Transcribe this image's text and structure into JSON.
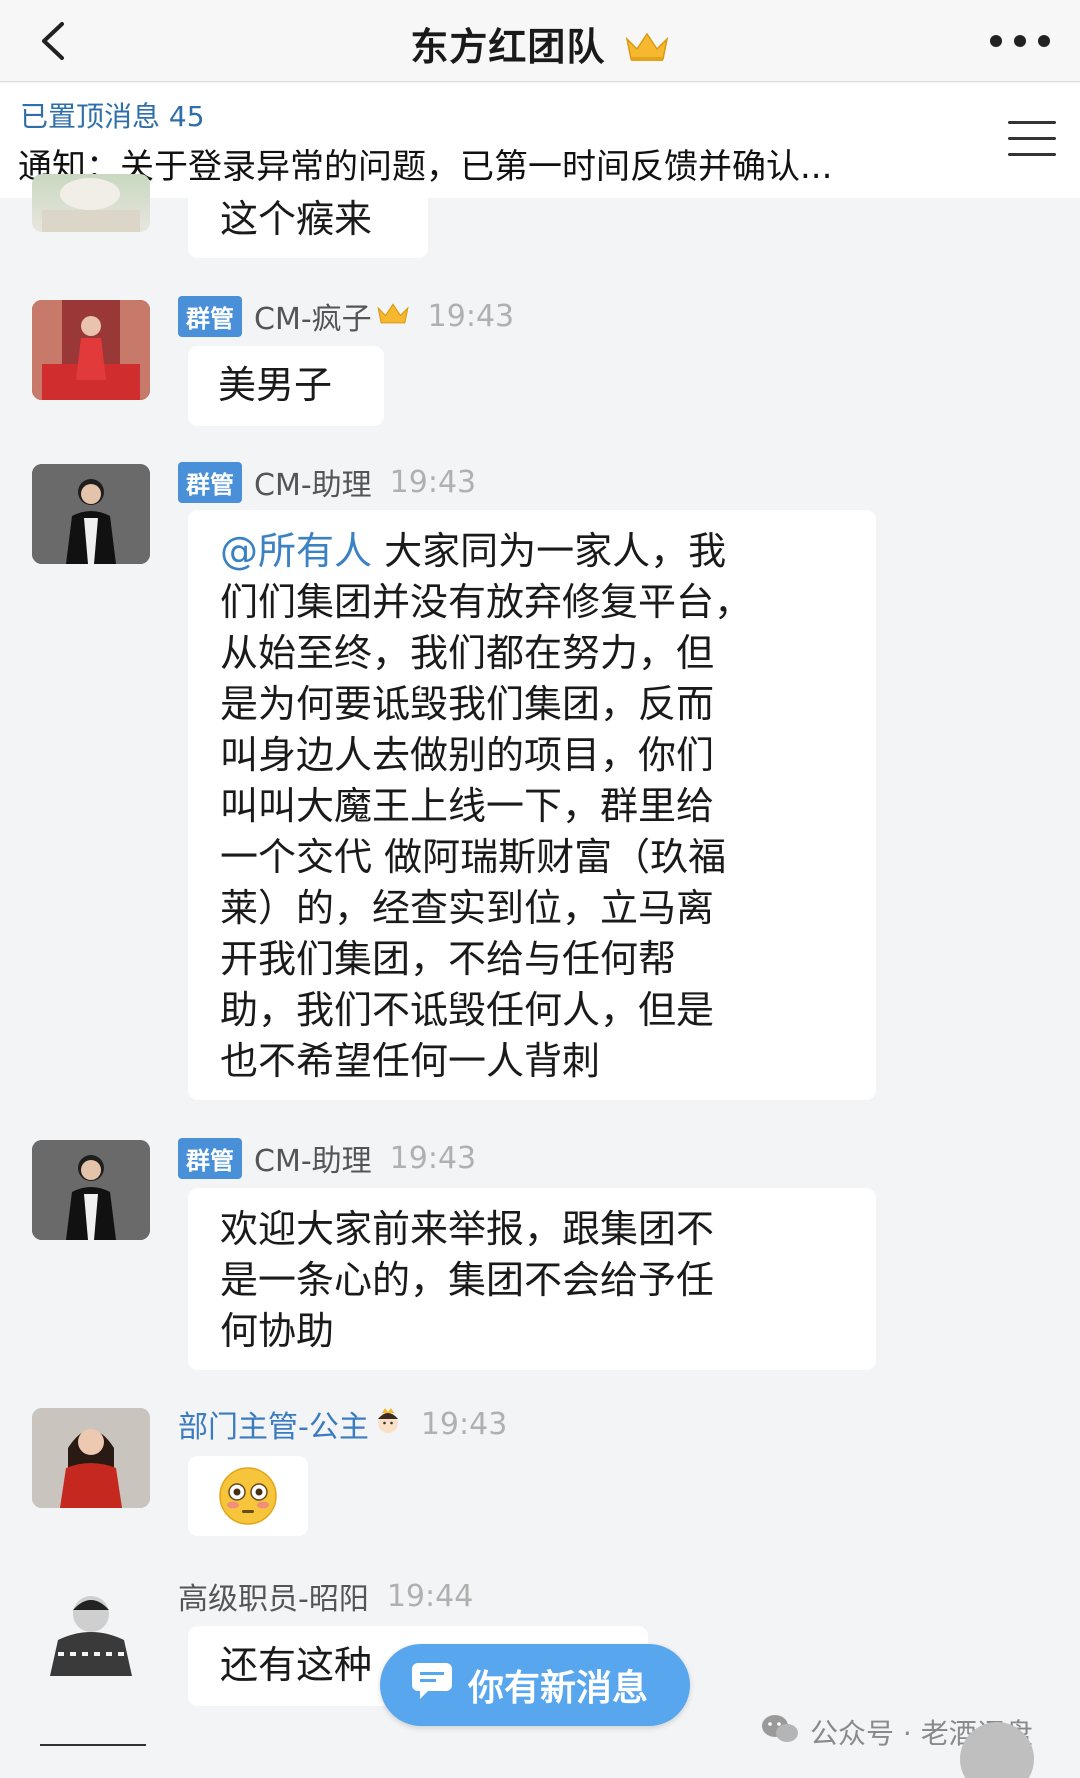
{
  "header": {
    "title": "东方红团队",
    "title_icon": "crown-icon",
    "back_icon": "chevron-left-icon",
    "more_icon": "more-dots-icon"
  },
  "pinned": {
    "label": "已置顶消息 45",
    "text": "通知：关于登录异常的问题，已第一时间反馈并确认...",
    "menu_icon": "list-menu-icon"
  },
  "messages": [
    {
      "text": "这个瘊来"
    },
    {
      "badge": "群管",
      "name": "CM-疯子",
      "name_icon": "crown-icon",
      "time": "19:43",
      "text": "美男子"
    },
    {
      "badge": "群管",
      "name": "CM-助理",
      "time": "19:43",
      "mention": "@所有人",
      "lines": [
        " 大家同为一家人，我",
        "们们集团并没有放弃修复平台，",
        "从始至终，我们都在努力，但",
        "是为何要诋毁我们集团，反而",
        "叫身边人去做别的项目，你们",
        "叫叫大魔王上线一下，群里给",
        "一个交代 做阿瑞斯财富（玖福",
        "莱）的，经查实到位，立马离",
        "开我们集团，不给与任何帮",
        "助，我们不诋毁任何人，但是",
        "也不希望任何一人背刺"
      ]
    },
    {
      "badge": "群管",
      "name": "CM-助理",
      "time": "19:43",
      "lines": [
        "欢迎大家前来举报，跟集团不",
        "是一条心的，集团不会给予任",
        "何协助"
      ]
    },
    {
      "name": "部门主管-公主",
      "name_icon": "princess-emoji-icon",
      "time": "19:43",
      "emoji": "flushed-face-emoji"
    },
    {
      "name": "高级职员-昭阳",
      "time": "19:44",
      "text": "还有这种"
    }
  ],
  "new_message_button": {
    "label": "你有新消息",
    "icon": "chat-bubble-icon"
  },
  "watermark": {
    "text": "公众号 · 老酒评盘",
    "icon": "wechat-icon"
  },
  "colors": {
    "accent": "#4a90d9",
    "mention": "#3b82c4",
    "pinned_label": "#2f6fa8",
    "new_message": "#58a6ee"
  }
}
